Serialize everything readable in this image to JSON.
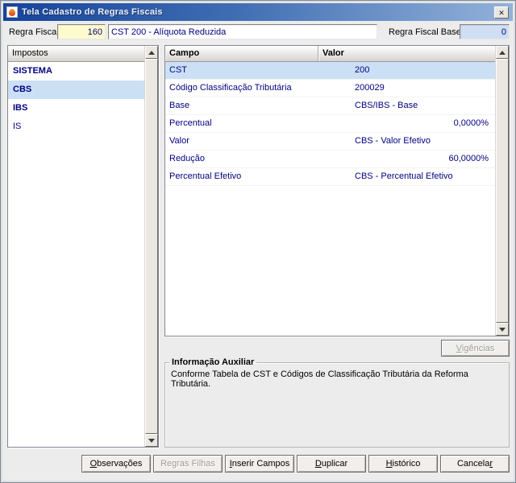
{
  "window": {
    "title": "Tela Cadastro de Regras Fiscais"
  },
  "header": {
    "regra_fiscal_label": "Regra Fiscal",
    "regra_fiscal_value": "160",
    "regra_descricao": "CST 200 - Alíquota Reduzida",
    "regra_fiscal_base_label": "Regra Fiscal Base",
    "regra_fiscal_base_value": "0"
  },
  "impostos": {
    "header": "Impostos",
    "items": [
      {
        "label": "SISTEMA",
        "bold": true,
        "selected": false
      },
      {
        "label": "CBS",
        "bold": true,
        "selected": true
      },
      {
        "label": "IBS",
        "bold": true,
        "selected": false
      },
      {
        "label": "IS",
        "bold": false,
        "selected": false
      }
    ]
  },
  "campos": {
    "headers": [
      "Campo",
      "Valor"
    ],
    "rows": [
      {
        "campo": "CST",
        "valor": "200",
        "align": "left",
        "selected": true
      },
      {
        "campo": "Código Classificação Tributária",
        "valor": "200029",
        "align": "left",
        "selected": false
      },
      {
        "campo": "Base",
        "valor": "CBS/IBS - Base",
        "align": "left",
        "selected": false
      },
      {
        "campo": "Percentual",
        "valor": "0,0000%",
        "align": "right",
        "selected": false
      },
      {
        "campo": "Valor",
        "valor": "CBS - Valor Efetivo",
        "align": "left",
        "selected": false
      },
      {
        "campo": "Redução",
        "valor": "60,0000%",
        "align": "right",
        "selected": false
      },
      {
        "campo": "Percentual Efetivo",
        "valor": "CBS - Percentual Efetivo",
        "align": "left",
        "selected": false
      }
    ]
  },
  "vigencias_button": {
    "label": "Vigências",
    "underline": 0,
    "disabled": true
  },
  "info_auxiliar": {
    "title": "Informação Auxiliar",
    "text": "Conforme Tabela de CST e Códigos de Classificação Tributária da Reforma Tributária."
  },
  "footer_buttons": [
    {
      "label": "Observações",
      "underline": 0,
      "disabled": false
    },
    {
      "label": "Regras Filhas",
      "underline": -1,
      "disabled": true
    },
    {
      "label": "Inserir Campos",
      "underline": 0,
      "disabled": false
    },
    {
      "label": "Duplicar",
      "underline": 0,
      "disabled": false
    },
    {
      "label": "Histórico",
      "underline": 0,
      "disabled": false
    },
    {
      "label": "Cancelar",
      "underline": 7,
      "disabled": false
    }
  ],
  "colors": {
    "titlebar_left": "#16439c",
    "titlebar_right": "#93b2d9",
    "selection": "#cce0f5",
    "grid_text": "#000080",
    "field_yellow": "#fdfacd",
    "field_blue": "#cfdef2"
  }
}
